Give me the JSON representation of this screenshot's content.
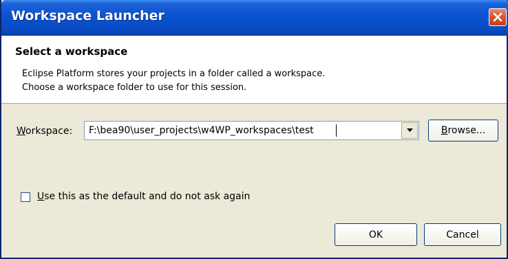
{
  "window": {
    "title": "Workspace Launcher",
    "close_icon": "close-icon"
  },
  "header": {
    "title": "Select a workspace",
    "line1": "Eclipse Platform stores your projects in a folder called a workspace.",
    "line2": "Choose a workspace folder to use for this session."
  },
  "workspace": {
    "label_mnemonic": "W",
    "label_rest": "orkspace:",
    "value": "F:\\bea90\\user_projects\\w4WP_workspaces\\test",
    "dropdown_icon": "chevron-down-icon"
  },
  "buttons": {
    "browse_mnemonic": "B",
    "browse_rest": "rowse...",
    "ok": "OK",
    "cancel": "Cancel"
  },
  "default_checkbox": {
    "checked": false,
    "label_mnemonic": "U",
    "label_rest": "se this as the default and do not ask again"
  },
  "colors": {
    "titlebar": "#0b52d0",
    "dialog_bg": "#ece9d8",
    "close_button": "#d8552e"
  }
}
